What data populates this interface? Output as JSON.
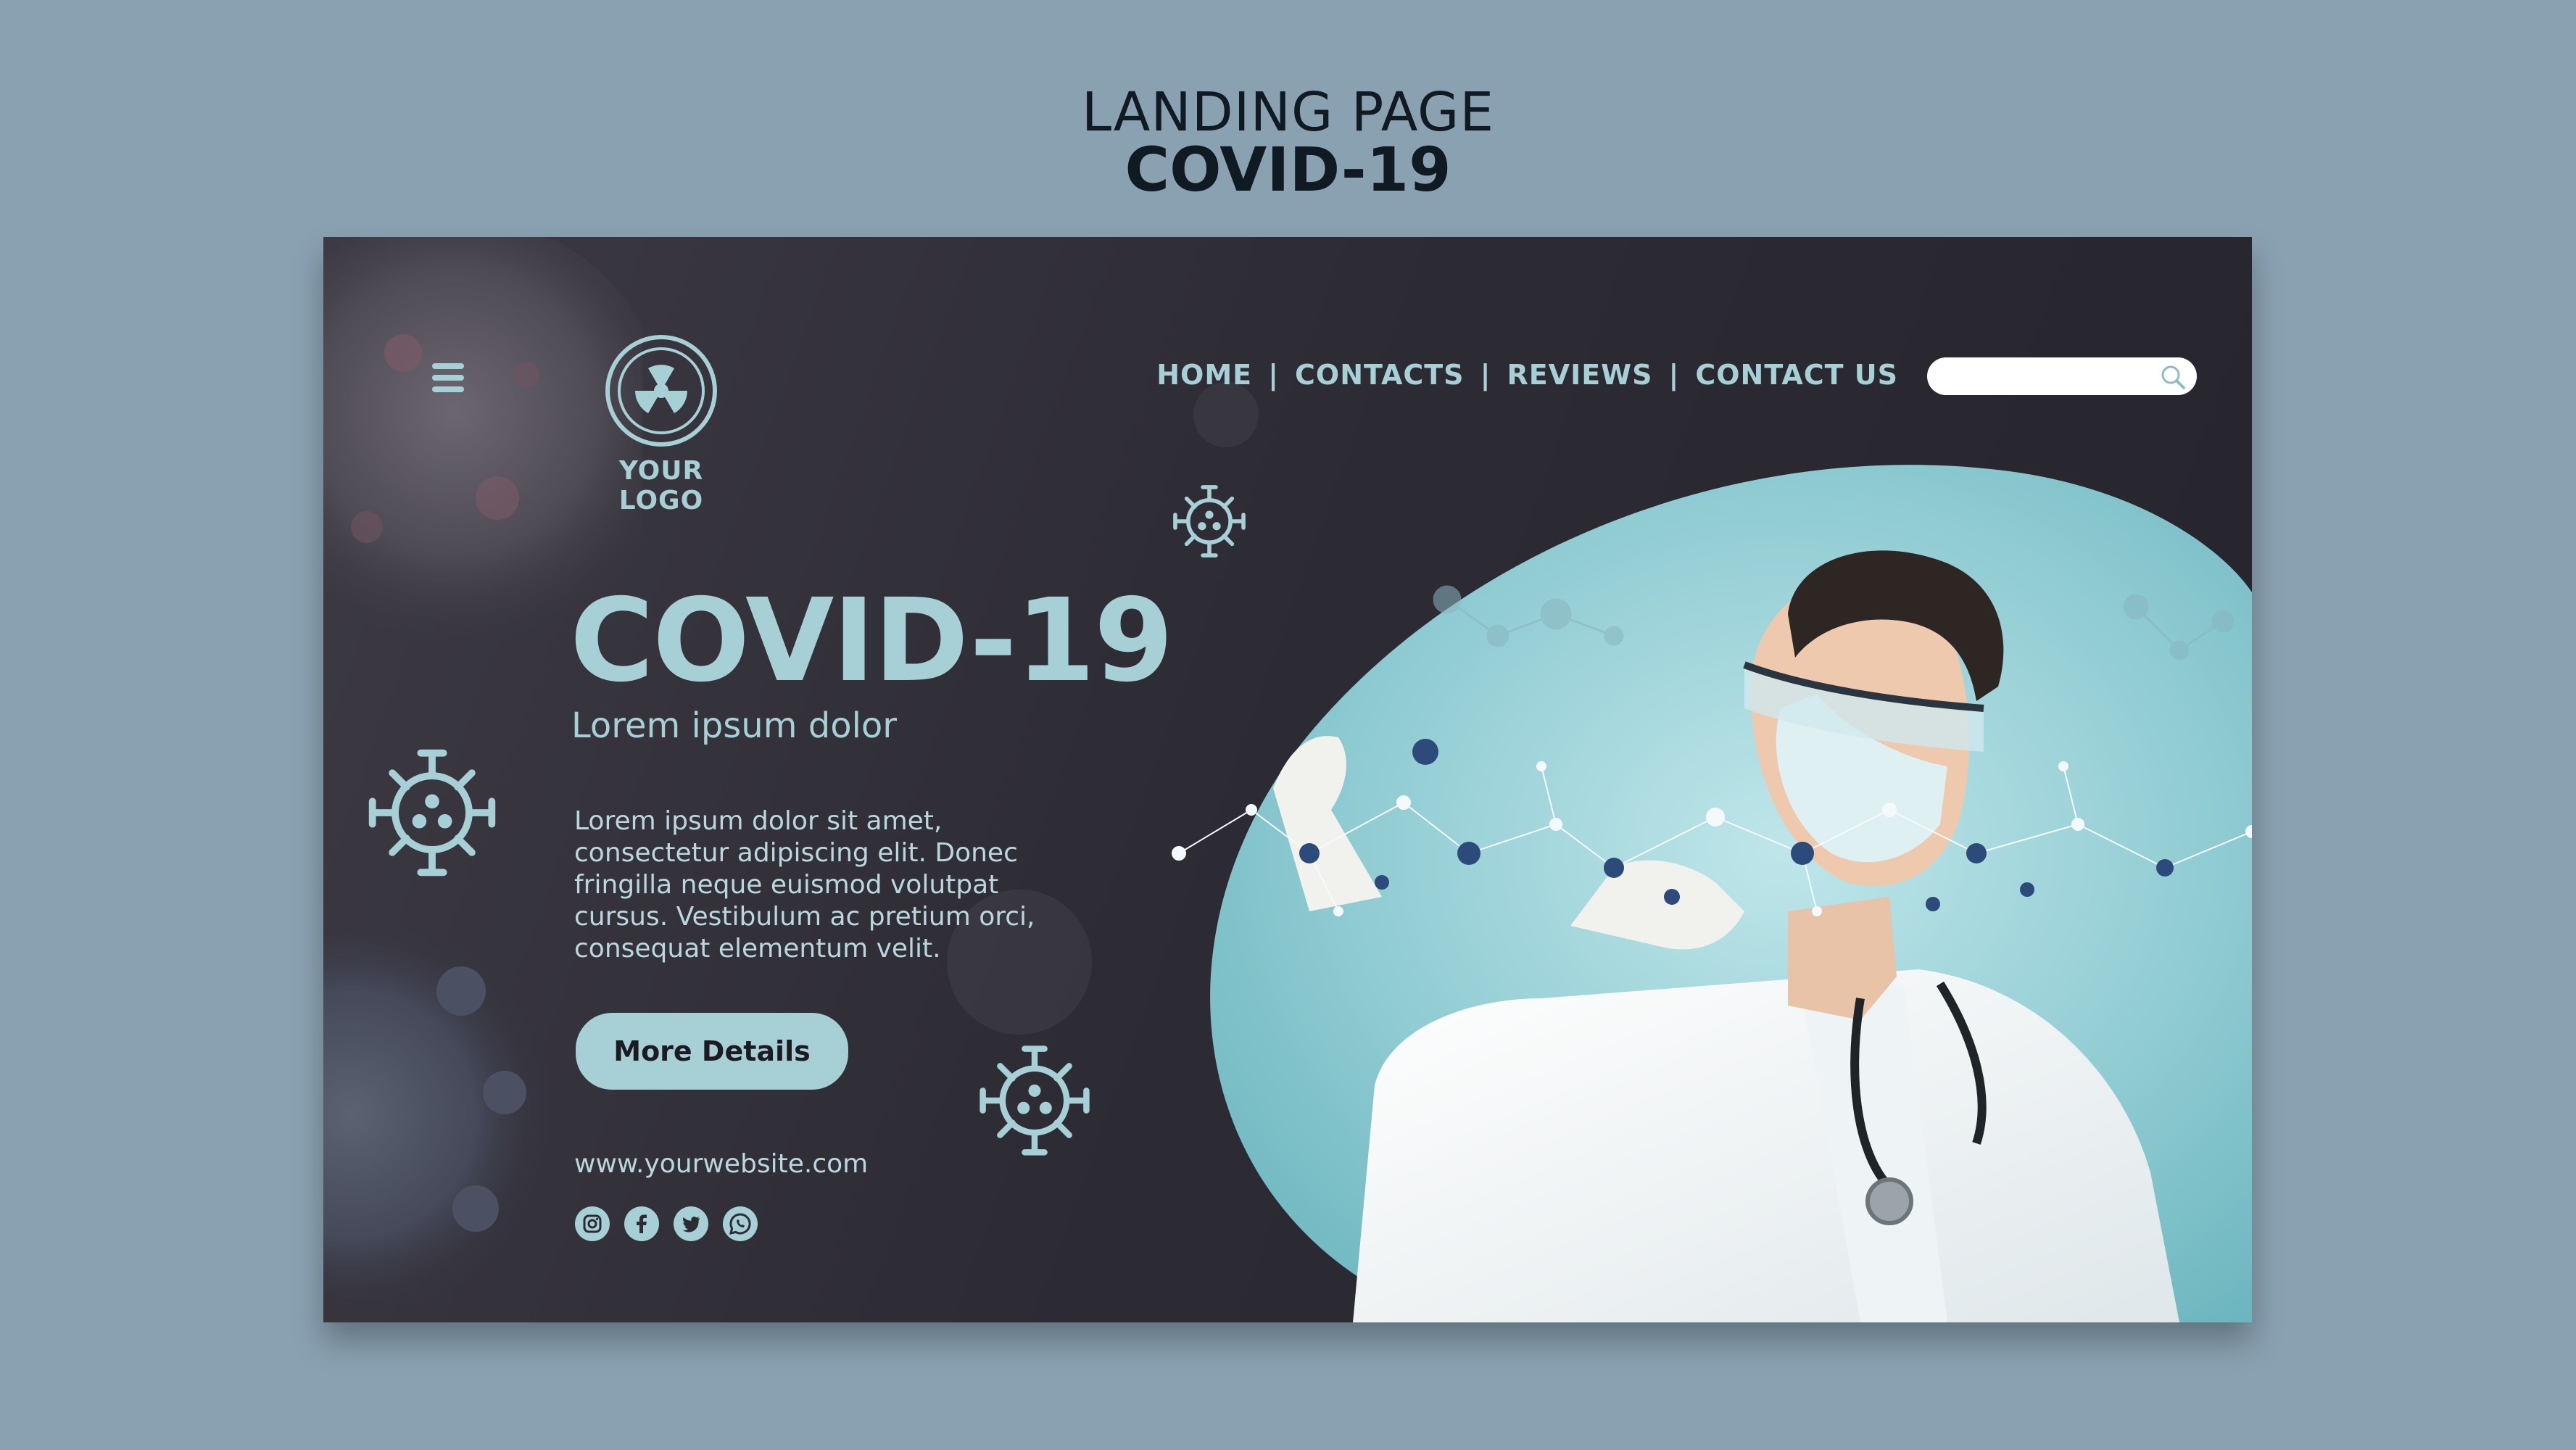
{
  "heading": {
    "line1": "LANDING PAGE",
    "line2": "COVID-19"
  },
  "logo": {
    "text": "YOUR LOGO",
    "icon": "radiation-icon"
  },
  "nav": {
    "items": [
      "HOME",
      "CONTACTS",
      "REVIEWS",
      "CONTACT US"
    ],
    "separator": "|"
  },
  "search": {
    "placeholder": "",
    "icon": "search-icon"
  },
  "hero": {
    "title": "COVID-19",
    "subtitle": "Lorem ipsum dolor",
    "body": "Lorem ipsum dolor sit amet, consectetur adipiscing elit. Donec fringilla neque euismod volutpat cursus. Vestibulum ac pretium orci, consequat elementum velit.",
    "cta": "More Details"
  },
  "footer": {
    "website": "www.yourwebsite.com",
    "socials": [
      "instagram-icon",
      "facebook-icon",
      "twitter-icon",
      "whatsapp-icon"
    ]
  },
  "colors": {
    "background": "#8aa1b1",
    "panel": "#2d2b34",
    "accent": "#a7cfd6",
    "heading": "#0f1a22"
  }
}
